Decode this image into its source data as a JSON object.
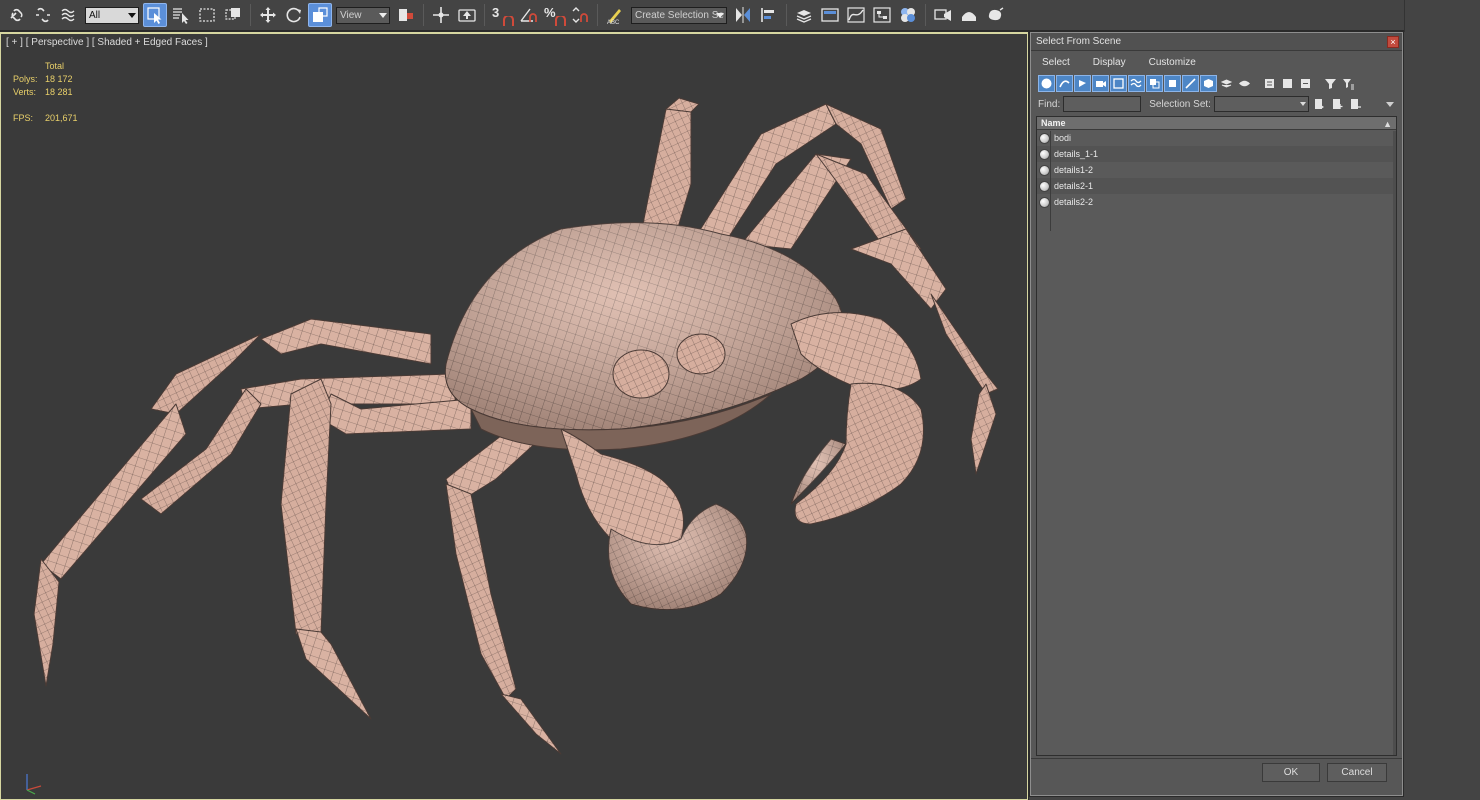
{
  "toolbar": {
    "filter_dropdown": "All",
    "ref_coord_dropdown": "View",
    "snap_labels": {
      "snap": "3",
      "percent": "%"
    },
    "named_selection_dropdown": "Create Selection Se"
  },
  "viewport": {
    "label": "[ + ] [ Perspective ] [ Shaded + Edged Faces ]",
    "stats": {
      "header": "Total",
      "polys_label": "Polys:",
      "polys_value": "18 172",
      "verts_label": "Verts:",
      "verts_value": "18 281",
      "fps_label": "FPS:",
      "fps_value": "201,671"
    },
    "colors": {
      "background": "#3a3a3a",
      "mesh": "#d9b2a2",
      "wire": "#5c4a44",
      "border": "#d6d6a0",
      "stats": "#e9d06a"
    }
  },
  "dialog": {
    "title": "Select From Scene",
    "menu": [
      "Select",
      "Display",
      "Customize"
    ],
    "find_label": "Find:",
    "find_value": "",
    "selection_set_label": "Selection Set:",
    "selection_set_value": "",
    "list": {
      "column_name": "Name",
      "items": [
        "bodi",
        "details_1-1",
        "details1-2",
        "details2-1",
        "details2-2"
      ]
    },
    "ok_label": "OK",
    "cancel_label": "Cancel",
    "accent": "#4d86c6"
  }
}
